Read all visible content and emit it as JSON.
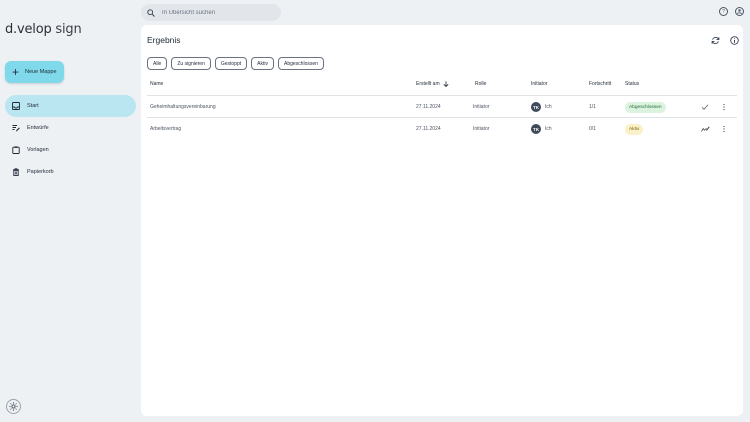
{
  "logo": {
    "brand_a": "d.velop",
    "brand_b": " sign"
  },
  "sidebar": {
    "new_button": "Neue Mappe",
    "items": [
      {
        "label": "Start",
        "icon": "inbox-icon",
        "active": true
      },
      {
        "label": "Entwürfe",
        "icon": "edit-list-icon",
        "active": false
      },
      {
        "label": "Vorlagen",
        "icon": "clipboard-icon",
        "active": false
      },
      {
        "label": "Papierkorb",
        "icon": "trash-icon",
        "active": false
      }
    ],
    "theme_icon": "sun-icon"
  },
  "search": {
    "placeholder": "In Übersicht suchen"
  },
  "main": {
    "title": "Ergebnis",
    "filters": [
      "Alle",
      "Zu signieren",
      "Gestoppt",
      "Aktiv",
      "Abgeschlossen"
    ],
    "columns": [
      "Name",
      "Erstellt am",
      "Rolle",
      "Initiator",
      "Fortschritt",
      "Status"
    ],
    "rows": [
      {
        "name": "Geheimhaltungsvereinbarung",
        "created": "27.11.2024",
        "role": "Initiator",
        "initials": "TK",
        "initiator": "Ich",
        "progress": "1/1",
        "status": "Abgeschlossen",
        "status_kind": "done",
        "action_icon": "checkmark-icon"
      },
      {
        "name": "Arbeitsvertrag",
        "created": "27.11.2024",
        "role": "Initiator",
        "initials": "TK",
        "initiator": "Ich",
        "progress": "0/1",
        "status": "Aktiv",
        "status_kind": "active",
        "action_icon": "signature-icon"
      }
    ]
  },
  "colors": {
    "accent": "#7fd9ea",
    "nav_active": "#b9e6f0",
    "background": "#eef1f4"
  }
}
